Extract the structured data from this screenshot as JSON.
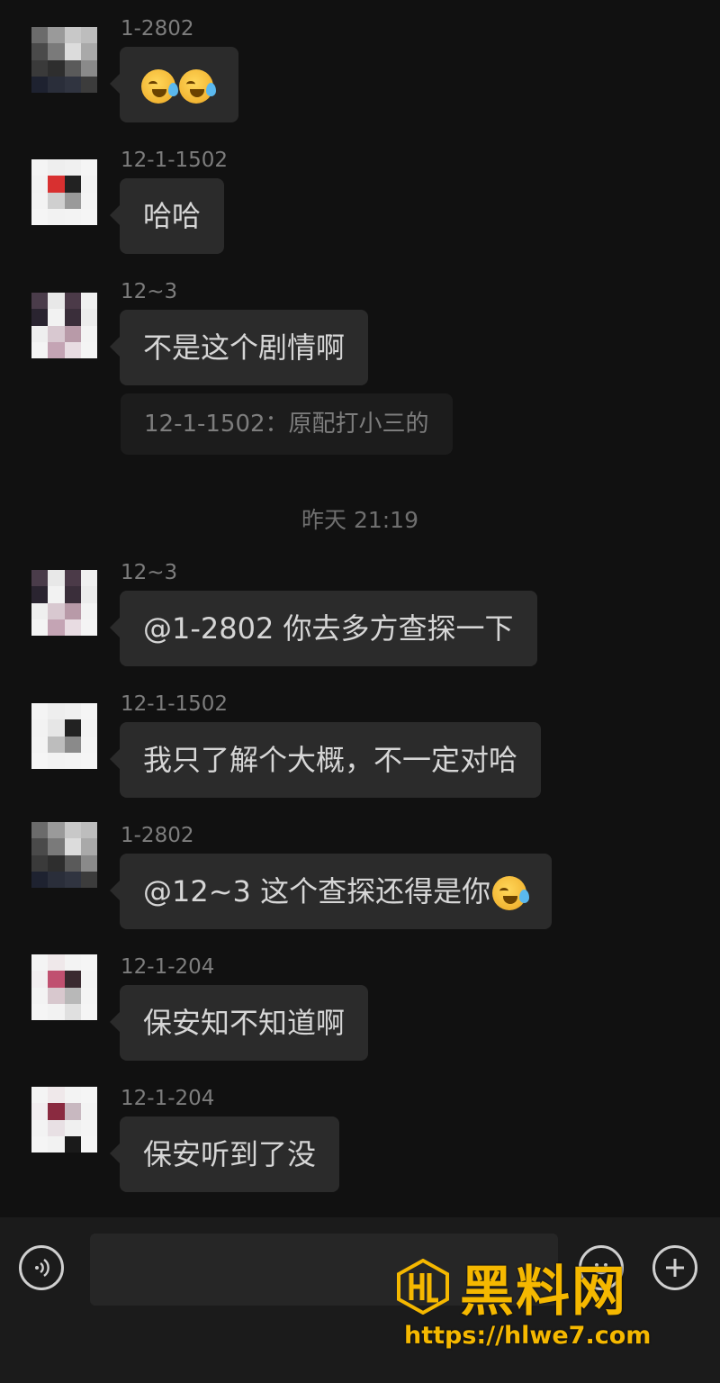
{
  "messages": [
    {
      "sender": "1-2802",
      "text": "",
      "emoji_count": 2,
      "emoji": "laughing-tears-emoji"
    },
    {
      "sender": "12-1-1502",
      "text": "哈哈"
    },
    {
      "sender": "12~3",
      "text": "不是这个剧情啊",
      "quote": "12-1-1502：原配打小三的"
    },
    {
      "sender": "12~3",
      "text": "@1-2802 你去多方查探一下"
    },
    {
      "sender": "12-1-1502",
      "text": "我只了解个大概，不一定对哈"
    },
    {
      "sender": "1-2802",
      "text": "@12~3 这个查探还得是你",
      "emoji_count": 1,
      "emoji": "laughing-tears-emoji"
    },
    {
      "sender": "12-1-204",
      "text": "保安知不知道啊"
    },
    {
      "sender": "12-1-204",
      "text": "保安听到了没"
    }
  ],
  "timestamp": "昨天 21:19",
  "input": {
    "voice_icon": "voice-icon",
    "emoji_icon": "emoji-icon",
    "plus_icon": "plus-icon"
  },
  "watermark": {
    "brand": "黑料网",
    "url": "https://hlwe7.com"
  },
  "colors": {
    "background": "#111111",
    "bubble": "#2b2b2b",
    "watermark": "#f5b800"
  }
}
